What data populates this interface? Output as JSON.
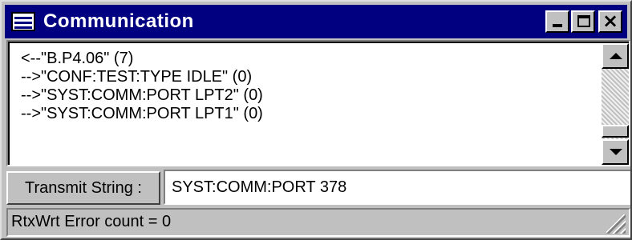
{
  "window": {
    "title": "Communication",
    "icon": "app-icon",
    "controls": {
      "minimize": "minimize-icon",
      "maximize": "maximize-icon",
      "close": "close-icon"
    },
    "colors": {
      "title_bar": "#000080",
      "chrome": "#c0c0c0"
    }
  },
  "log": {
    "lines": [
      "<--\"B.P4.06\" (7)",
      "-->\"CONF:TEST:TYPE IDLE\" (0)",
      "-->\"SYST:COMM:PORT LPT2\" (0)",
      "-->\"SYST:COMM:PORT LPT1\" (0)"
    ]
  },
  "transmit": {
    "button_label": "Transmit String :",
    "value": "SYST:COMM:PORT 378"
  },
  "status": {
    "text": "RtxWrt Error count = 0"
  }
}
